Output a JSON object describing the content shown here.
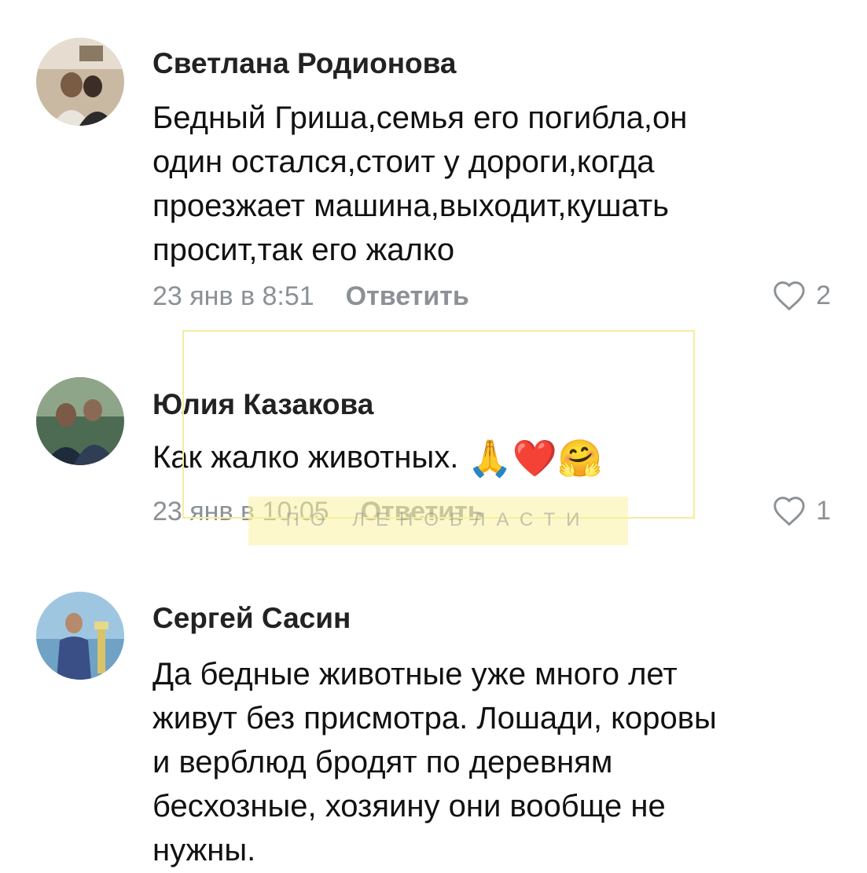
{
  "comments": [
    {
      "author": "Светлана Родионова",
      "lines": [
        "Бедный Гриша,семья его погибла,он",
        "один остался,стоит у дороги,когда",
        "проезжает машина,выходит,кушать",
        "просит,так его жалко"
      ],
      "date": "23 янв в 8:51",
      "reply": "Ответить",
      "likes": "2",
      "avatar_icon": "avatar-photo"
    },
    {
      "author": "Юлия Казакова",
      "text": "Как жалко животных.",
      "emojis": [
        "🙏",
        "❤️",
        "🤗"
      ],
      "date": "23 янв в 10:05",
      "reply": "Ответить",
      "likes": "1",
      "avatar_icon": "avatar-photo"
    },
    {
      "author": "Сергей Сасин",
      "lines": [
        "Да бедные животные уже много лет",
        "живут без присмотра. Лошади, коровы",
        "и верблюд бродят по деревням",
        "бесхозные, хозяину они вообще не",
        "нужны."
      ],
      "avatar_icon": "avatar-photo"
    }
  ],
  "watermark": "ПО ЛЕНОБЛАСТИ",
  "colors": {
    "meta": "#8c9196",
    "watermark_band": "#faf2a0"
  },
  "icons": {
    "like": "heart-outline-icon"
  }
}
